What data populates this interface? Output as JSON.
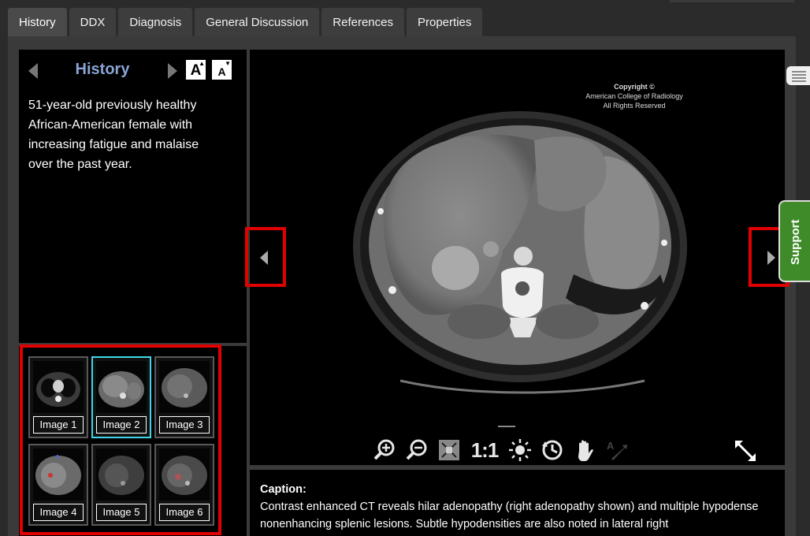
{
  "tabs": [
    {
      "label": "History",
      "active": true
    },
    {
      "label": "DDX"
    },
    {
      "label": "Diagnosis"
    },
    {
      "label": "General Discussion"
    },
    {
      "label": "References"
    },
    {
      "label": "Properties"
    }
  ],
  "history": {
    "title": "History",
    "text": "51-year-old previously healthy African-American female with increasing fatigue and malaise over the past year.",
    "font_increase_glyph": "A",
    "font_decrease_glyph": "A"
  },
  "thumbnails": [
    {
      "label": "Image 1"
    },
    {
      "label": "Image 2",
      "selected": true
    },
    {
      "label": "Image 3"
    },
    {
      "label": "Image 4"
    },
    {
      "label": "Image 5"
    },
    {
      "label": "Image 6"
    }
  ],
  "viewer": {
    "copyright_line1": "Copyright ©",
    "copyright_line2": "American College of Radiology",
    "copyright_line3": "All Rights Reserved",
    "tools": [
      "zoom-in-icon",
      "zoom-out-icon",
      "fit-icon",
      "one-to-one",
      "brightness-icon",
      "reset-icon",
      "pan-hand-icon",
      "annotate-icon"
    ],
    "one_to_one_label": "1:1"
  },
  "caption": {
    "title": "Caption:",
    "text": "Contrast enhanced CT reveals hilar adenopathy (right adenopathy shown) and multiple hypodense nonenhancing splenic lesions. Subtle hypodensities are also noted in lateral right"
  },
  "side": {
    "support_label": "Support"
  },
  "colors": {
    "highlight_red": "#e00000",
    "history_title": "#8aa4d6",
    "selected_thumb": "#40d8e8",
    "support_green": "#3f8b2a"
  }
}
